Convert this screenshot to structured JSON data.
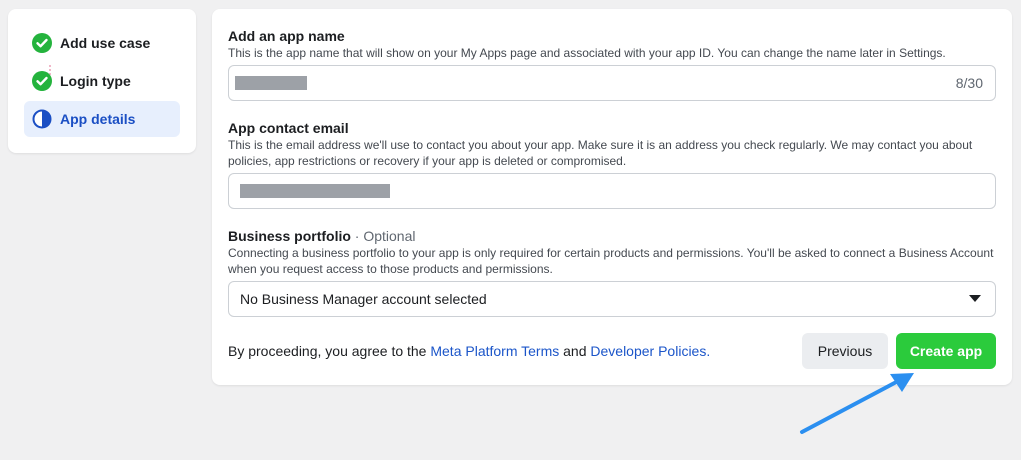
{
  "steps": [
    {
      "label": "Add use case",
      "state": "complete"
    },
    {
      "label": "Login type",
      "state": "complete"
    },
    {
      "label": "App details",
      "state": "current"
    }
  ],
  "app_name": {
    "title": "Add an app name",
    "description": "This is the app name that will show on your My Apps page and associated with your app ID. You can change the name later in Settings.",
    "counter": "8/30"
  },
  "contact_email": {
    "title": "App contact email",
    "description": "This is the email address we'll use to contact you about your app. Make sure it is an address you check regularly. We may contact you about policies, app restrictions or recovery if your app is deleted or compromised."
  },
  "business_portfolio": {
    "title": "Business portfolio",
    "optional_label": "· Optional",
    "description": "Connecting a business portfolio to your app is only required for certain products and permissions. You'll be asked to connect a Business Account when you request access to those products and permissions.",
    "selected": "No Business Manager account selected"
  },
  "footer": {
    "prefix": "By proceeding, you agree to the",
    "link1": "Meta Platform Terms",
    "middle": "and",
    "link2": "Developer Policies."
  },
  "buttons": {
    "previous": "Previous",
    "create": "Create app"
  },
  "colors": {
    "accent_green": "#2bcb3c",
    "check_green": "#24b33d",
    "link_blue": "#1b55c9",
    "current_step_bg": "#e7effd",
    "annotation_arrow": "#2b8ff0"
  }
}
